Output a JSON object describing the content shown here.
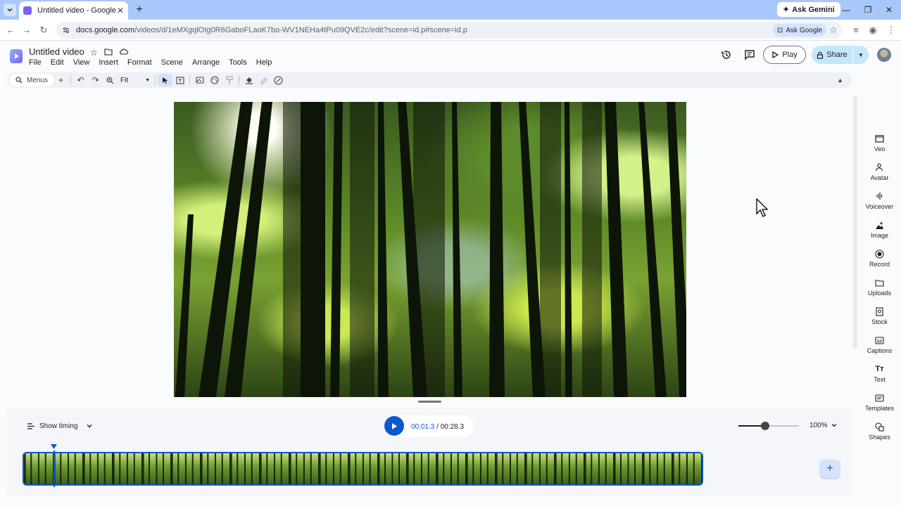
{
  "browser": {
    "tab_title": "Untitled video - Google Vids",
    "new_tab": "+",
    "ask_gemini": "Ask Gemini",
    "url_host": "docs.google.com",
    "url_path": "/videos/d/1eMXgqlOIg0R6GaboFLaoK7bo-WV1NEHa4tPu09QVE2c/edit?scene=id.p#scene=id.p",
    "ask_google": "Ask Google"
  },
  "app": {
    "title": "Untitled video",
    "menus": [
      "File",
      "Edit",
      "View",
      "Insert",
      "Format",
      "Scene",
      "Arrange",
      "Tools",
      "Help"
    ],
    "play_label": "Play",
    "share_label": "Share",
    "accent_color": "#0b57d0",
    "share_bg": "#c2e7ff"
  },
  "toolbar": {
    "search_label": "Menus",
    "zoom_label": "Fit"
  },
  "side_panel": {
    "items": [
      "Veo",
      "Avatar",
      "Voiceover",
      "Image",
      "Record",
      "Uploads",
      "Stock",
      "Captions",
      "Text",
      "Templates",
      "Shapes"
    ]
  },
  "timeline": {
    "show_timing": "Show timing",
    "current_time": "00:01.3",
    "separator": " / ",
    "total_time": "00:28.3",
    "zoom_value": "100%",
    "zoom_level": 0.44,
    "playhead_fraction": 0.046
  }
}
